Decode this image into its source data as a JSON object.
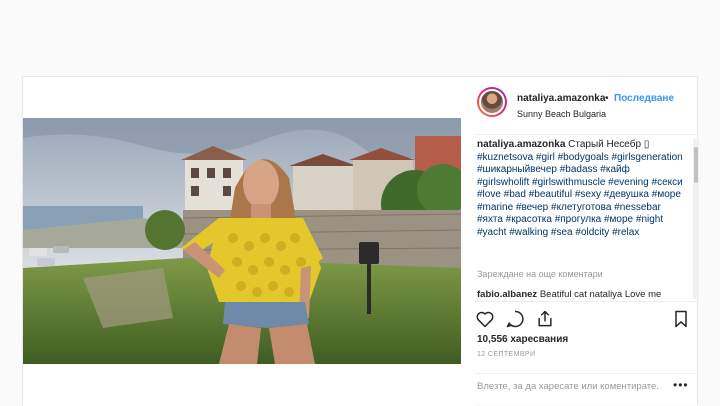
{
  "post": {
    "username": "nataliya.amazonka",
    "separator": "•",
    "follow_label": "Последване",
    "location": "Sunny Beach Bulgaria",
    "caption_user": "nataliya.amazonka",
    "caption_text": "Старый Несебр ▯",
    "hashtags": "#kuznetsova #girl #bodygoals #girlsgeneration #шикарныйвечер #badass #кайф #girlswholift #girlswithmuscle #evening #секси #love #bad #beautiful #sexy #девушка #море #marine #вечер #клетуготова #nessebar #яхта #красотка #прогулка #море #night #yacht #walking #sea #oldcity #relax",
    "load_more": "Зареждане на още коментари",
    "comment_user": "fabio.albanez",
    "comment_text": "Beatiful cat nataliya Love me",
    "likes": "10,556 харесвания",
    "date": "12 СЕПТЕМВРИ",
    "add_comment": "Влезте, за да харесате или коментирате.",
    "more_label": "•••"
  },
  "icons": {
    "like": "heart-icon",
    "comment": "comment-icon",
    "share": "share-icon",
    "save": "bookmark-icon"
  },
  "colors": {
    "accent": "#3897f0",
    "hashtag": "#003569",
    "muted": "#999999"
  }
}
